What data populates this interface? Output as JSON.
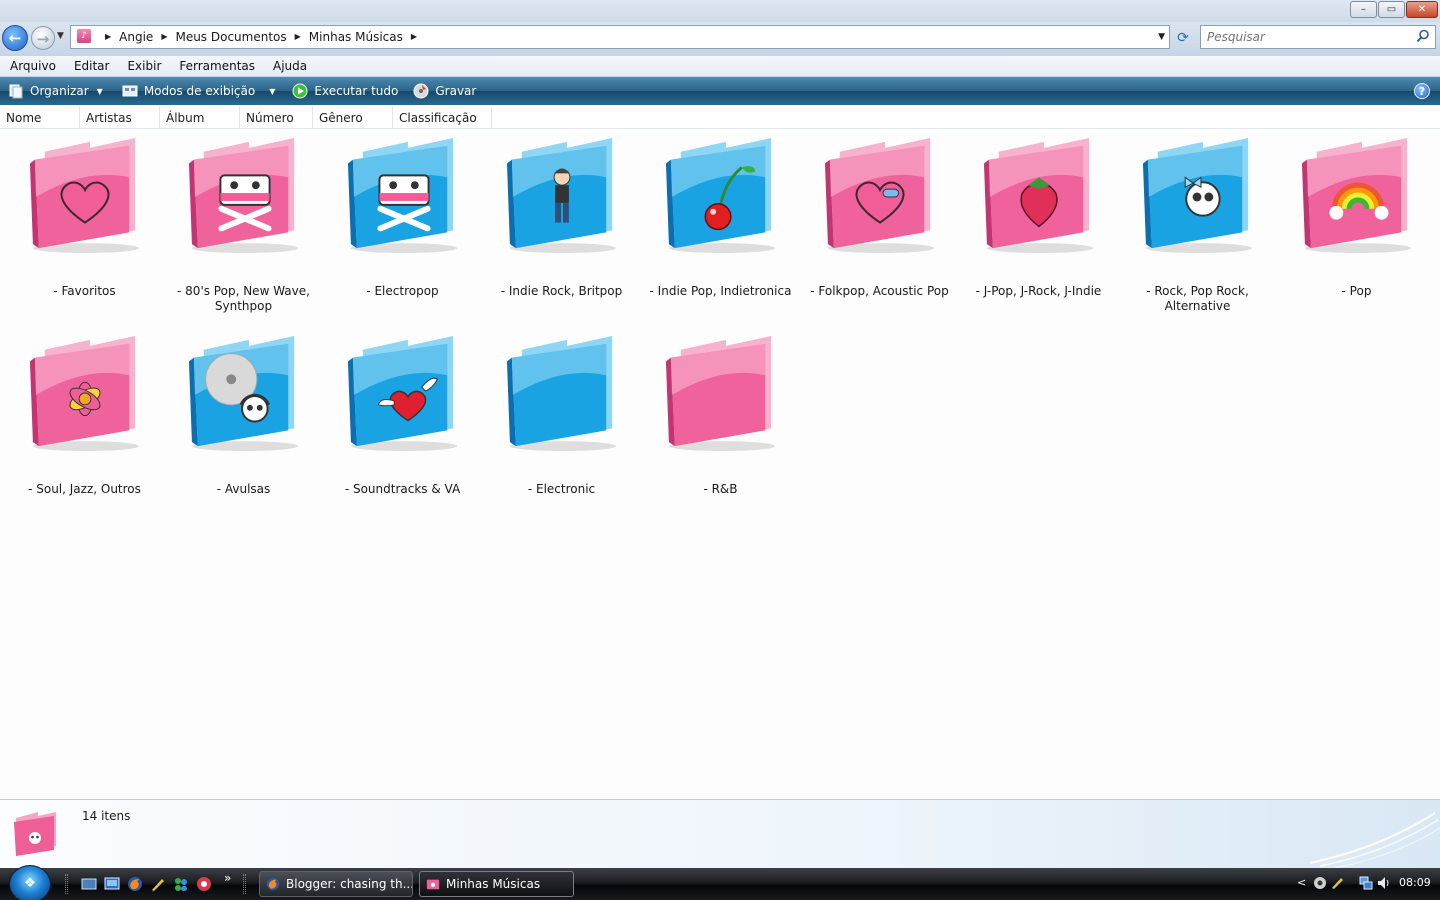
{
  "window": {
    "controls": {
      "minimize": "–",
      "maximize": "▭",
      "close": "✕"
    }
  },
  "addressbar": {
    "breadcrumbs": [
      "Angie",
      "Meus Documentos",
      "Minhas Músicas"
    ],
    "search_placeholder": "Pesquisar"
  },
  "menubar": {
    "items": [
      "Arquivo",
      "Editar",
      "Exibir",
      "Ferramentas",
      "Ajuda"
    ]
  },
  "commandbar": {
    "organize": "Organizar",
    "views": "Modos de exibição",
    "play_all": "Executar tudo",
    "burn": "Gravar",
    "help": "?"
  },
  "columns": [
    "Nome",
    "Artistas",
    "Álbum",
    "Número",
    "Gênero",
    "Classificação"
  ],
  "folders": [
    {
      "name": "- Favoritos",
      "color": "pink",
      "icon": "heart-icon"
    },
    {
      "name": "- 80's Pop, New Wave, Synthpop",
      "color": "pink",
      "icon": "cassette-crossbones-icon"
    },
    {
      "name": "- Electropop",
      "color": "blue",
      "icon": "cassette-crossbones-icon"
    },
    {
      "name": "- Indie Rock, Britpop",
      "color": "blue",
      "icon": "indie-boy-icon"
    },
    {
      "name": "- Indie Pop, Indietronica",
      "color": "blue",
      "icon": "cherry-icon"
    },
    {
      "name": "- Folkpop, Acoustic Pop",
      "color": "pink",
      "icon": "patched-heart-icon"
    },
    {
      "name": "- J-Pop, J-Rock, J-Indie",
      "color": "pink",
      "icon": "strawberry-icon"
    },
    {
      "name": "- Rock, Pop Rock, Alternative",
      "color": "blue",
      "icon": "skull-bow-icon"
    },
    {
      "name": "- Pop",
      "color": "pink",
      "icon": "rainbow-icon"
    },
    {
      "name": "- Soul, Jazz, Outros",
      "color": "pink",
      "icon": "flower-icon"
    },
    {
      "name": "- Avulsas",
      "color": "blue",
      "icon": "music-cd-skull-icon"
    },
    {
      "name": "- Soundtracks & VA",
      "color": "blue",
      "icon": "winged-heart-icon"
    },
    {
      "name": "- Electronic",
      "color": "blue",
      "icon": "none"
    },
    {
      "name": "- R&B",
      "color": "pink",
      "icon": "none"
    }
  ],
  "details": {
    "count": "14 itens"
  },
  "taskbar": {
    "more": "»",
    "tasks": [
      {
        "label": "Blogger: chasing th...",
        "icon": "firefox-icon"
      },
      {
        "label": "Minhas Músicas",
        "icon": "folder-icon"
      }
    ],
    "tray_arrow": "<",
    "clock": "08:09"
  },
  "colors": {
    "folder_pink": "#f25c97",
    "folder_blue": "#1a9ee0",
    "cmdbar": "#2b6288",
    "taskbar": "#141619"
  }
}
